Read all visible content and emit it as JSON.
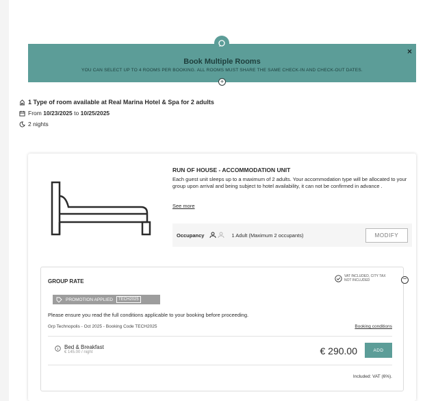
{
  "banner": {
    "title": "Book Multiple Rooms",
    "subtitle": "YOU CAN SELECT UP TO 4 ROOMS PER BOOKING. ALL ROOMS MUST SHARE THE SAME CHECK-IN AND CHECK-OUT DATES.",
    "close": "×",
    "add": "+",
    "color": "#5c9d98"
  },
  "summary": {
    "rooms_line": "1 Type of room available at Real Marina Hotel & Spa for 2 adults",
    "dates_prefix": "From",
    "date_from": "10/23/2025",
    "dates_mid": "to",
    "date_to": "10/25/2025",
    "nights": "2 nights"
  },
  "room": {
    "title": "RUN OF HOUSE - ACCOMMODATION UNIT",
    "description": "Each guest unit sleeps up to a maximum of 2 adults. Your accommodation type will be allocated to your group upon arrival and being subject to hotel availability, it can not be confirmed in advance .",
    "see_more": "See more",
    "occupancy_label": "Occupancy",
    "occupancy_text": "1 Adult (Maximum 2 occupants)",
    "modify": "MODIFY"
  },
  "rate": {
    "title": "GROUP RATE",
    "vat_note": "VAT INCLUDED, CITY TAX NOT INCLUDED",
    "toggle": "−",
    "promo_label": "PROMOTION APPLIED",
    "promo_code": "TECH2025",
    "ensure_text": "Please ensure you read the full conditions applicable to your booking before proceeding.",
    "group_info": "Grp Technopolis - Oct 2025 - Booking Code TECH2025",
    "booking_conditions": "Booking conditions",
    "board_name": "Bed & Breakfast",
    "price_per_night": "€ 145.00 / night",
    "price": "€ 290.00",
    "add": "ADD",
    "included": "Included: VAT (6%)."
  }
}
